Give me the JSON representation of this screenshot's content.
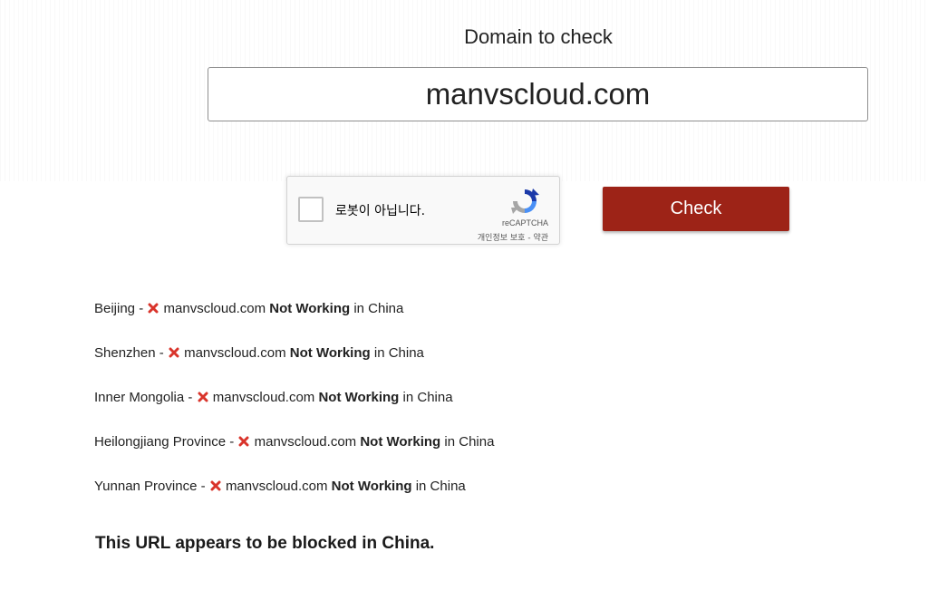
{
  "header": {
    "label": "Domain to check"
  },
  "search": {
    "value": "manvscloud.com"
  },
  "recaptcha": {
    "label": "로봇이 아닙니다.",
    "brand": "reCAPTCHA",
    "privacy": "개인정보 보호",
    "separator": " - ",
    "terms": "약관"
  },
  "actions": {
    "check_label": "Check"
  },
  "colors": {
    "button": "#9d2317",
    "error_icon": "#d9342b"
  },
  "results": [
    {
      "location": "Beijing",
      "sep": " - ",
      "domain": "manvscloud.com",
      "status": "Not Working",
      "suffix": "in China",
      "icon": "x-icon"
    },
    {
      "location": "Shenzhen",
      "sep": " - ",
      "domain": "manvscloud.com",
      "status": "Not Working",
      "suffix": "in China",
      "icon": "x-icon"
    },
    {
      "location": "Inner Mongolia",
      "sep": " - ",
      "domain": "manvscloud.com",
      "status": "Not Working",
      "suffix": "in China",
      "icon": "x-icon"
    },
    {
      "location": "Heilongjiang Province",
      "sep": " - ",
      "domain": "manvscloud.com",
      "status": "Not Working",
      "suffix": "in China",
      "icon": "x-icon"
    },
    {
      "location": "Yunnan Province",
      "sep": " - ",
      "domain": "manvscloud.com",
      "status": "Not Working",
      "suffix": "in China",
      "icon": "x-icon"
    }
  ],
  "summary": {
    "text": "This URL appears to be blocked in China."
  }
}
